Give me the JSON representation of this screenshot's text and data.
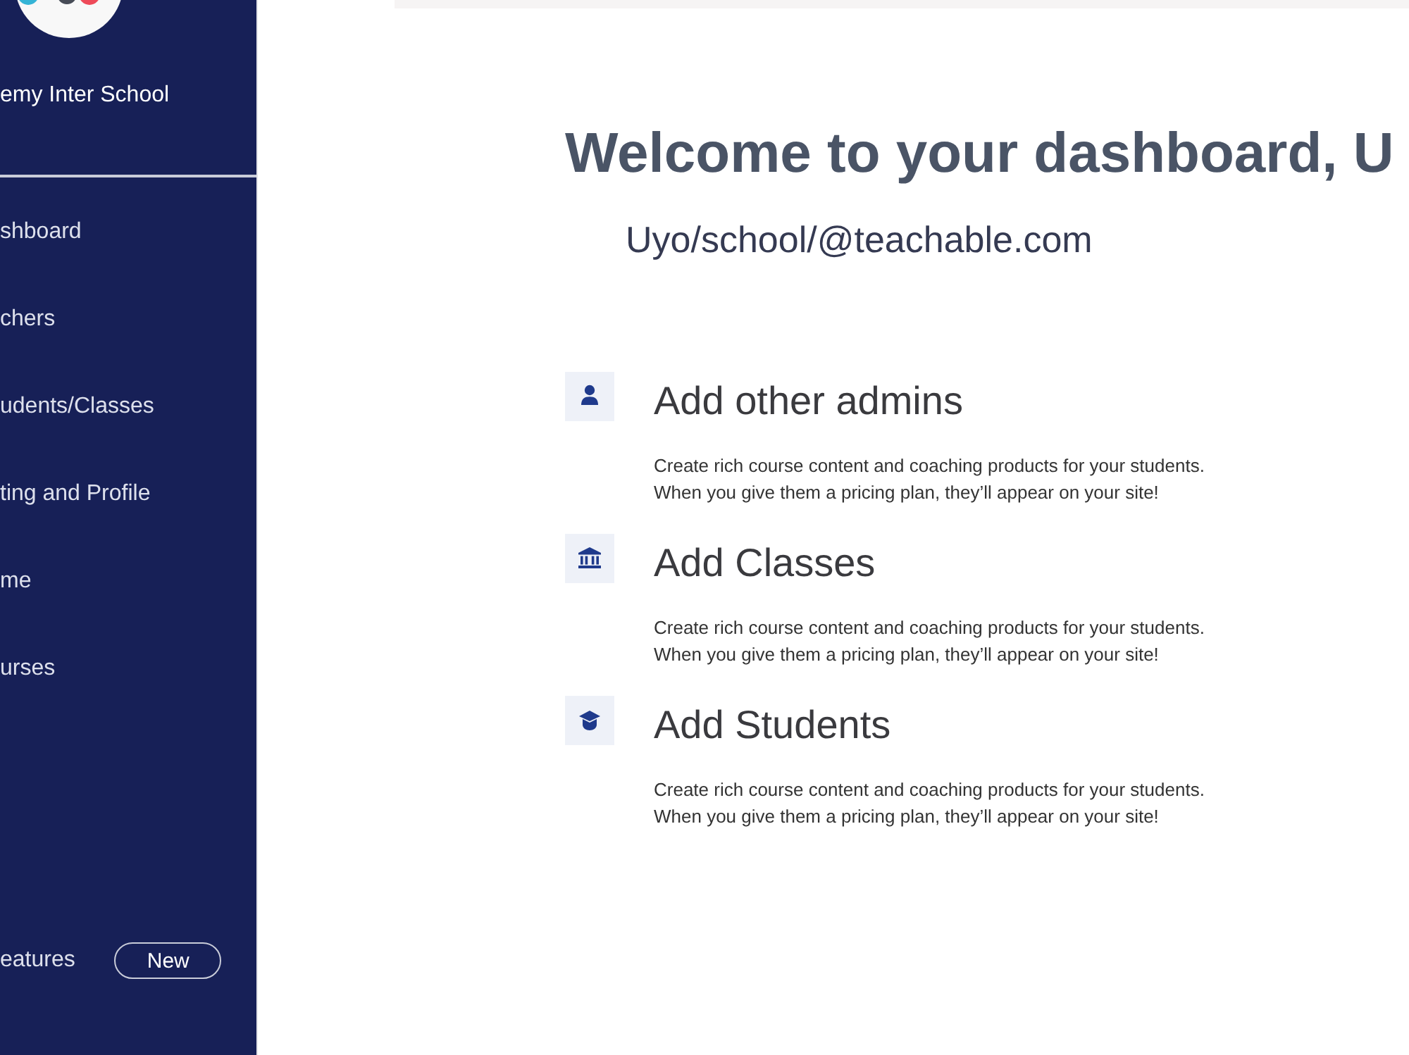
{
  "sidebar": {
    "school_name": "emy Inter School",
    "nav_items": [
      {
        "label": "shboard"
      },
      {
        "label": "chers"
      },
      {
        "label": "udents/Classes"
      },
      {
        "label": "ting and Profile"
      },
      {
        "label": "me"
      },
      {
        "label": "urses"
      }
    ],
    "footer_item": {
      "label": "eatures",
      "badge": "New"
    }
  },
  "header": {
    "title": "Welcome to your dashboard, U",
    "subtitle": "Uyo/school/@teachable.com"
  },
  "actions": [
    {
      "title": "Add other admins",
      "description": "Create rich course content and coaching products for your students.\nWhen you give them a pricing plan, they’ll appear on your site!"
    },
    {
      "title": "Add Classes",
      "description": "Create rich course content and coaching products for your students.\nWhen you give them a pricing plan, they’ll appear on your site!"
    },
    {
      "title": "Add Students",
      "description": "Create rich course content and coaching products for your students.\nWhen you give them a pricing plan, they’ll appear on your site!"
    }
  ]
}
